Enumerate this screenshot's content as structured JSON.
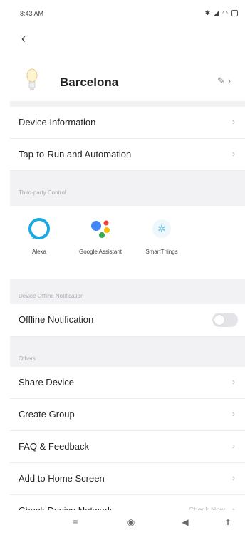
{
  "status_bar": {
    "time": "8:43 AM"
  },
  "header": {
    "device_name": "Barcelona"
  },
  "menu_top": [
    {
      "label": "Device Information"
    },
    {
      "label": "Tap-to-Run and Automation"
    }
  ],
  "third_party": {
    "section_title": "Third-party Control",
    "items": [
      {
        "label": "Alexa"
      },
      {
        "label": "Google Assistant"
      },
      {
        "label": "SmartThings"
      }
    ]
  },
  "offline": {
    "section_title": "Device Offline Notification",
    "label": "Offline Notification",
    "enabled": false
  },
  "others": {
    "section_title": "Others",
    "items": [
      {
        "label": "Share Device"
      },
      {
        "label": "Create Group"
      },
      {
        "label": "FAQ & Feedback"
      },
      {
        "label": "Add to Home Screen"
      },
      {
        "label": "Check Device Network",
        "extra": "Check Now"
      }
    ]
  },
  "colors": {
    "alexa": "#1aa8e0",
    "google_blue": "#4285f4",
    "google_red": "#ea4335",
    "google_yellow": "#fbbc05",
    "google_green": "#34a853",
    "smartthings": "#6ec6e6"
  }
}
